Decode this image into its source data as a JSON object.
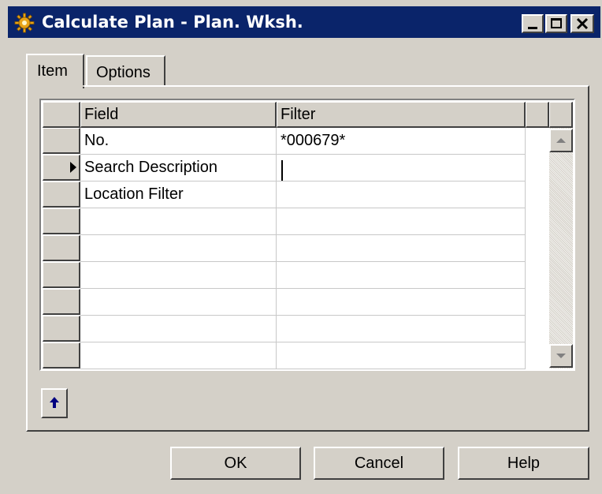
{
  "window": {
    "title": "Calculate Plan - Plan. Wksh.",
    "icon": "gear-icon",
    "controls": [
      "minimize-icon",
      "maximize-icon",
      "close-icon"
    ]
  },
  "tabs": [
    {
      "label": "Item",
      "active": true
    },
    {
      "label": "Options",
      "active": false
    }
  ],
  "grid": {
    "columns": [
      "Field",
      "Filter"
    ],
    "rows": [
      {
        "field": "No.",
        "filter": "*000679*"
      },
      {
        "field": "Search Description",
        "filter": "",
        "current": true
      },
      {
        "field": "Location Filter",
        "filter": ""
      },
      {
        "field": "",
        "filter": ""
      },
      {
        "field": "",
        "filter": ""
      },
      {
        "field": "",
        "filter": ""
      },
      {
        "field": "",
        "filter": ""
      },
      {
        "field": "",
        "filter": ""
      },
      {
        "field": "",
        "filter": ""
      }
    ]
  },
  "buttons": {
    "ok": "OK",
    "cancel": "Cancel",
    "help": "Help"
  },
  "colors": {
    "titlebar": "#0a246a",
    "face": "#d4d0c8",
    "arrow": "#000080"
  }
}
